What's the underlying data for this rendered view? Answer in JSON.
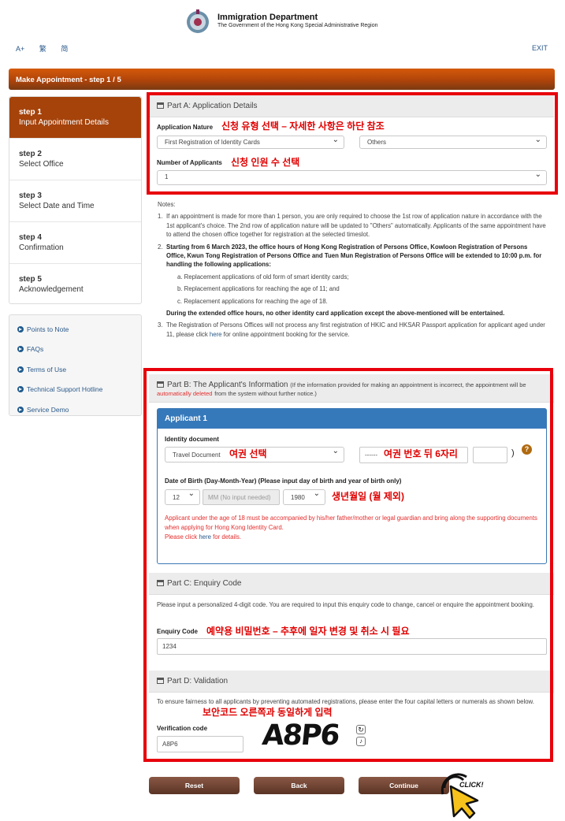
{
  "header": {
    "dept": "Immigration Department",
    "gov": "The Government of the Hong Kong Special Administrative Region",
    "tools": [
      "A+",
      "繁",
      "简"
    ],
    "exit": "EXIT"
  },
  "title": "Make Appointment - step 1 / 5",
  "steps": [
    {
      "n": "step 1",
      "l": "Input Appointment Details"
    },
    {
      "n": "step 2",
      "l": "Select Office"
    },
    {
      "n": "step 3",
      "l": "Select Date and Time"
    },
    {
      "n": "step 4",
      "l": "Confirmation"
    },
    {
      "n": "step 5",
      "l": "Acknowledgement"
    }
  ],
  "links": [
    "Points to Note",
    "FAQs",
    "Terms of Use",
    "Technical Support Hotline",
    "Service Demo"
  ],
  "partA": {
    "title": "Part A: Application Details",
    "nature_label": "Application Nature",
    "nature_value": "First Registration of Identity Cards",
    "nature2_value": "Others",
    "num_label": "Number of Applicants",
    "num_value": "1",
    "kr_nature": "신청 유형 선택 – 자세한 사항은 하단 참조",
    "kr_num": "신청 인원 수 선택"
  },
  "notes": {
    "head": "Notes:",
    "n1": "If an appointment is made for more than 1 person, you are only required to choose the 1st row of application nature in accordance with the 1st applicant's choice. The 2nd row of application nature will be updated to \"Others\" automatically. Applicants of the same appointment have to attend the chosen office together for registration at the selected timeslot.",
    "n2": "Starting from 6 March 2023, the office hours of Hong Kong Registration of Persons Office, Kowloon Registration of Persons Office, Kwun Tong Registration of Persons Office and Tuen Mun Registration of Persons Office will be extended to 10:00 p.m. for handling the following applications:",
    "n2a": "a. Replacement applications of old form of smart identity cards;",
    "n2b": "b. Replacement applications for reaching the age of 11; and",
    "n2c": "c. Replacement applications for reaching the age of 18.",
    "n2d": "During the extended office hours, no other identity card application except the above-mentioned will be entertained.",
    "n3a": "The Registration of Persons Offices will not process any first registration of HKIC and HKSAR Passport application for applicant aged under 11, please click ",
    "n3link": "here",
    "n3b": " for online appointment booking for the service."
  },
  "partB": {
    "title": "Part B: The Applicant's Information",
    "note1": "(If the information provided for making an appointment is incorrect, the appointment will be",
    "note_red": "automatically deleted",
    "note2": "from the system without further notice.)",
    "applicant": "Applicant 1",
    "id_label": "Identity document",
    "id_value": "Travel Document",
    "id_prefix": "------",
    "paren": ")",
    "help": "?",
    "kr_id": "여권 선택",
    "kr_no": "여권 번호 뒤 6자리",
    "dob_label": "Date of Birth (Day-Month-Year) (Please input day of birth and year of birth only)",
    "day": "12",
    "month": "MM (No input needed)",
    "year": "1980",
    "kr_dob": "생년월일 (월 제외)",
    "warn": "Applicant under the age of 18 must be accompanied by his/her father/mother or legal guardian and bring along the supporting documents when applying for Hong Kong Identity Card.",
    "warn2a": "Please click ",
    "warn2link": "here",
    "warn2b": " for details."
  },
  "partC": {
    "title": "Part C: Enquiry Code",
    "desc": "Please input a personalized 4-digit code. You are required to input this enquiry code to change, cancel or enquire the appointment booking.",
    "label": "Enquiry Code",
    "value": "1234",
    "kr": "예약용 비밀번호 – 추후에 일자 변경 및 취소 시 필요"
  },
  "partD": {
    "title": "Part D: Validation",
    "desc": "To ensure fairness to all applicants by preventing automated registrations, please enter the four capital letters or numerals as shown below.",
    "label": "Verification code",
    "value": "A8P6",
    "captcha": "A8P6",
    "kr": "보안코드 오른쪽과 동일하게 입력"
  },
  "buttons": {
    "reset": "Reset",
    "back": "Back",
    "continue": "Continue"
  },
  "click": "CLICK!"
}
